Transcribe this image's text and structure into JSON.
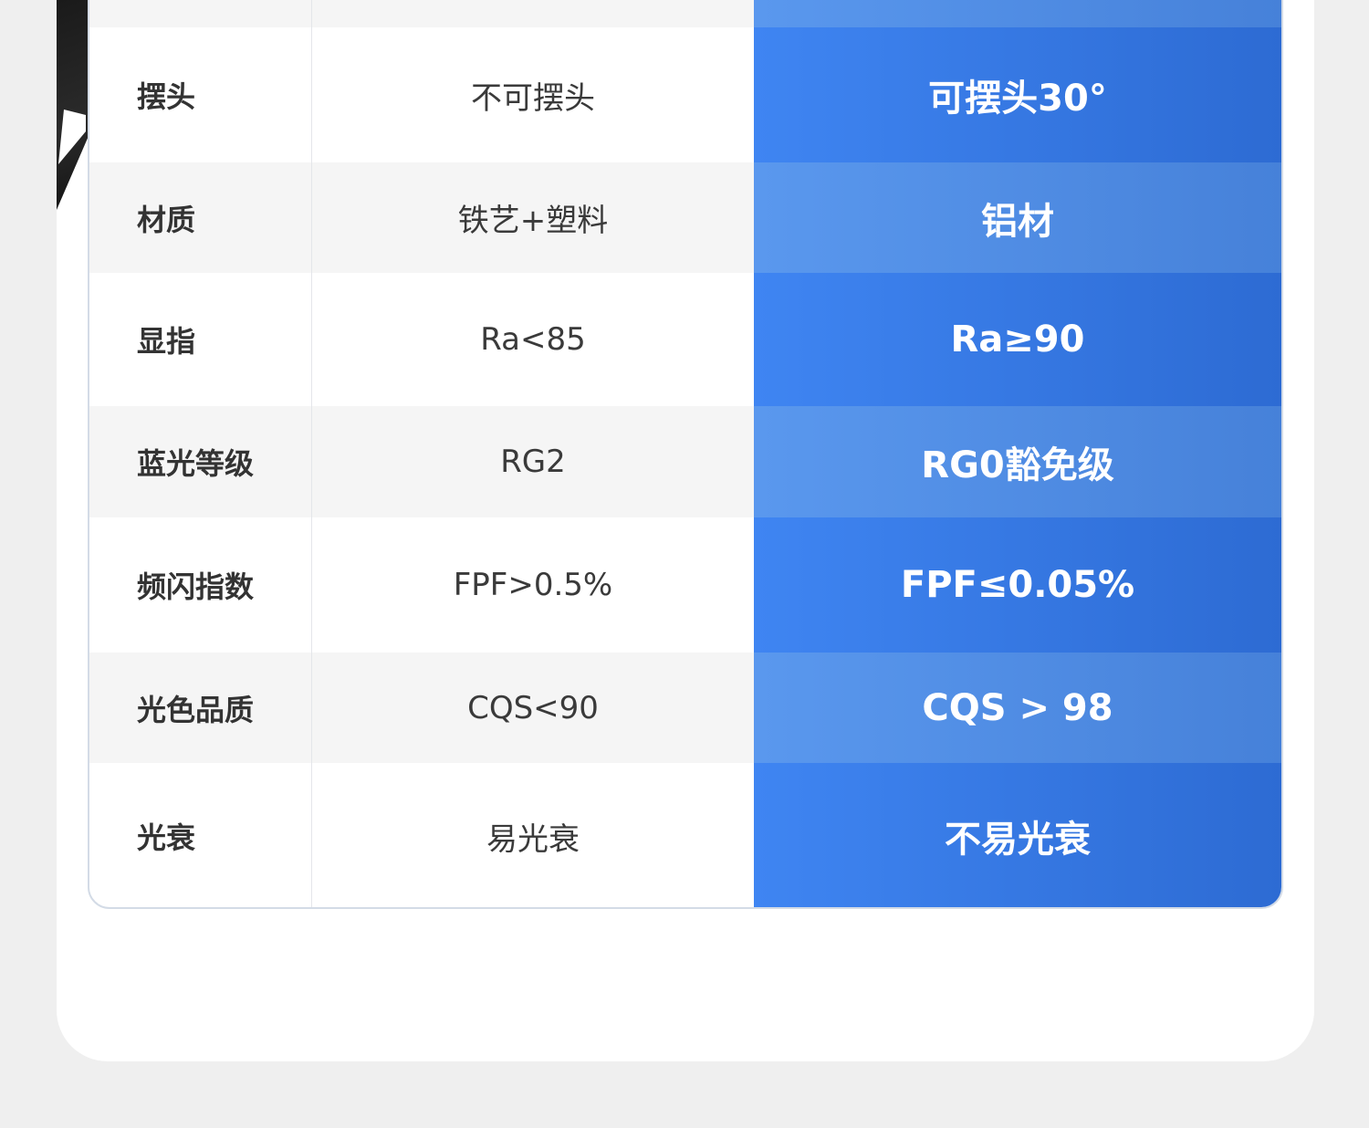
{
  "comparison_table": {
    "rows": [
      {
        "label": "",
        "old": "",
        "new": ""
      },
      {
        "label": "摆头",
        "old": "不可摆头",
        "new": "可摆头30°"
      },
      {
        "label": "材质",
        "old": "铁艺+塑料",
        "new": "铝材"
      },
      {
        "label": "显指",
        "old": "Ra<85",
        "new": "Ra≥90"
      },
      {
        "label": "蓝光等级",
        "old": "RG2",
        "new": "RG0豁免级"
      },
      {
        "label": "频闪指数",
        "old": "FPF>0.5%",
        "new": "FPF≤0.05%"
      },
      {
        "label": "光色品质",
        "old": "CQS<90",
        "new": "CQS > 98"
      },
      {
        "label": "光衰",
        "old": "易光衰",
        "new": "不易光衰"
      }
    ]
  },
  "colors": {
    "page_background": "#efefef",
    "card_background": "#ffffff",
    "highlight_blue": "#3f85f2",
    "highlight_blue_light": "#5a98ee"
  }
}
